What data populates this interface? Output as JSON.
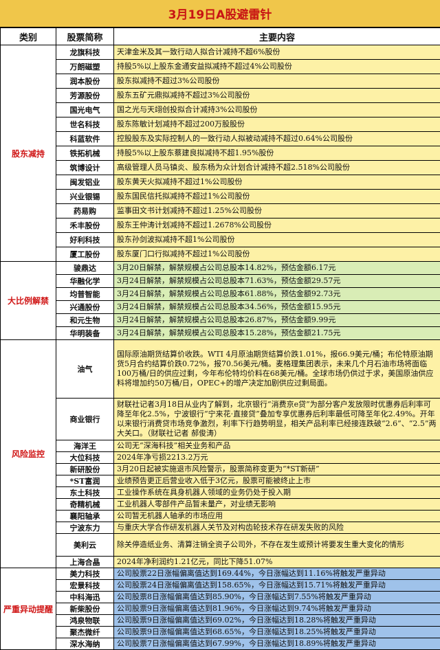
{
  "title": "3月19日A股避雷针",
  "headers": [
    "类别",
    "股票简称",
    "主要内容"
  ],
  "sections": [
    {
      "category": "股东减持",
      "theme": "yellow",
      "rows": [
        {
          "name": "龙旗科技",
          "content": "天津金米及其一致行动人拟合计减持不超6%股份"
        },
        {
          "name": "万朗磁塑",
          "content": "持股5%以上股东金通安益拟减持不超过4%公司股份"
        },
        {
          "name": "润本股份",
          "content": "股东拟减持不超过3%公司股份"
        },
        {
          "name": "芳源股份",
          "content": "股东五矿元鼎拟减持不超过3%公司股份"
        },
        {
          "name": "国光电气",
          "content": "国之光与天翊创投拟合计减持3%公司股份"
        },
        {
          "name": "世名科技",
          "content": "股东陈敏计划减持不超过200万股股份"
        },
        {
          "name": "科蓝软件",
          "content": "控股股东及实际控制人的一致行动人拟被动减持不超过0.64%公司股份"
        },
        {
          "name": "铁拓机械",
          "content": "持股5%以上股东蔡建良拟减持不超1.95%股份"
        },
        {
          "name": "筑博设计",
          "content": "高级管理人员马镇炎、股东杨为众计划合计减持不超2.518%公司股份"
        },
        {
          "name": "闽发铝业",
          "content": "股东黄天火拟减持不超过1%公司股份"
        },
        {
          "name": "兴业银锡",
          "content": "股东国民信托拟减持不超过1%公司股份"
        },
        {
          "name": "药易购",
          "content": "监事田文书计划减持不超过1.25%公司股份"
        },
        {
          "name": "禾丰股份",
          "content": "股东王仲涛计划减持不超过1.2678%公司股份"
        },
        {
          "name": "好利科技",
          "content": "股东孙剑波拟减持不超1%公司股份"
        },
        {
          "name": "厦工股份",
          "content": "股东厦门口行拟减持不超过1%公司股份"
        }
      ]
    },
    {
      "category": "大比例解禁",
      "theme": "green",
      "rows": [
        {
          "name": "骏鼎达",
          "content": "3月20日解禁，解禁规模占公司总股本14.82%，预估金额6.17元"
        },
        {
          "name": "华融化学",
          "content": "3月24日解禁，解禁规模占公司总股本71.63%，预估金额29.57元"
        },
        {
          "name": "均普智能",
          "content": "3月24日解禁，解禁规模占公司总股本61.88%，预估金额92.73元"
        },
        {
          "name": "兴通股份",
          "content": "3月24日解禁，解禁规模占公司总股本34.56%，预估金额15.95元"
        },
        {
          "name": "和元生物",
          "content": "3月24日解禁，解禁规模占公司总股本26.87%，预估金额9.99元"
        },
        {
          "name": "华明装备",
          "content": "3月24日解禁，解禁规模占公司总股本15.28%，预估金额21.75元"
        }
      ]
    },
    {
      "category": "风险监控",
      "theme": "yellow",
      "rows": [
        {
          "name": "油气",
          "content": "国际原油期货结算价收跌。WTI 4月原油期货结算价跌1.01%，报66.9美元/桶；布伦特原油期货5月合约结算价跌0.72%，报70.56美元/桶。麦格理集团表示，未来几个月石油市场将面临100万桶/日的供应过剩，今年布伦特均价料在68美元/桶。全球市场仍供过于求，美国原油供应料将增加约50万桶/日，OPEC+的增产决定加剧供应过剩局面。"
        },
        {
          "name": "商业银行",
          "content": "财联社记者3月18日从业内了解到，北京银行“消费京e贷”为部分客户发放限时优惠券后利率可降至年化2.5%，宁波银行“宁来花·直接贷”叠加专享优惠券后利率最低可降至年化2.49%。开年以来银行消费贷市场竞争激烈，利率下行趋势明显，相关产品利率已经接连跌破“2.6”、“2.5”两大关口。（财联社记者 郝俊涛）"
        },
        {
          "name": "海洋王",
          "content": "公司无“深海科技”相关业务和产品"
        },
        {
          "name": "大位科技",
          "content": "2024年净亏损2213.2万元"
        },
        {
          "name": "新研股份",
          "content": "3月20日起被实施退市风险警示，股票简称变更为“*ST新研”"
        },
        {
          "name": "*ST富润",
          "content": "业绩预告更正后营业收入低于3亿元，股票可能被终止上市"
        },
        {
          "name": "东土科技",
          "content": "工业操作系统在具身机器人领域的业务仍处于投入期"
        },
        {
          "name": "奇精机械",
          "content": "工业机器人零部件产品暂未量产，对业绩无影响"
        },
        {
          "name": "襄阳轴承",
          "content": "公司暂无机器人轴承的市场应用"
        },
        {
          "name": "宁波东力",
          "content": "与重庆大学合作研发机器人关节及对构齿轮技术存在研发失败的风险"
        },
        {
          "name": "美利云",
          "content": "除关停造纸业务、清算注销全资子公司外，不存在发生或预计将要发生重大变化的情形"
        },
        {
          "name": "上海合晶",
          "content": "2024年净利润约1.21亿元，同比下降51.07%"
        }
      ]
    },
    {
      "category": "严重异动提醒",
      "theme": "blue",
      "rows": [
        {
          "name": "美力科技",
          "content": "公司股票22日涨幅偏离值达到169.44%，今日涨幅达到11.16%将触发严重异动"
        },
        {
          "name": "宏景科技",
          "content": "公司股票24日涨幅偏离值达到158.65%，今日涨幅达到15.71%将触发严重异动"
        },
        {
          "name": "中科海迅",
          "content": "公司股票8日涨幅偏离值达到85.90%，今日涨幅达到7.55%将触发严重异动"
        },
        {
          "name": "新柴股份",
          "content": "公司股票9日涨幅偏离值达到81.96%，今日涨幅达到9.74%将触发严重异动"
        },
        {
          "name": "鸿泉物联",
          "content": "公司股票9日涨幅偏离值达到69.02%，今日涨幅达到18.28%将触发严重异动"
        },
        {
          "name": "聚杰微纤",
          "content": "公司股票9日涨幅偏离值达到68.65%，今日涨幅达到18.25%将触发严重异动"
        },
        {
          "name": "深水海纳",
          "content": "公司股票7日涨幅偏离值达到67.99%，今日涨幅达到18.89%将触发严重异动"
        }
      ]
    }
  ]
}
